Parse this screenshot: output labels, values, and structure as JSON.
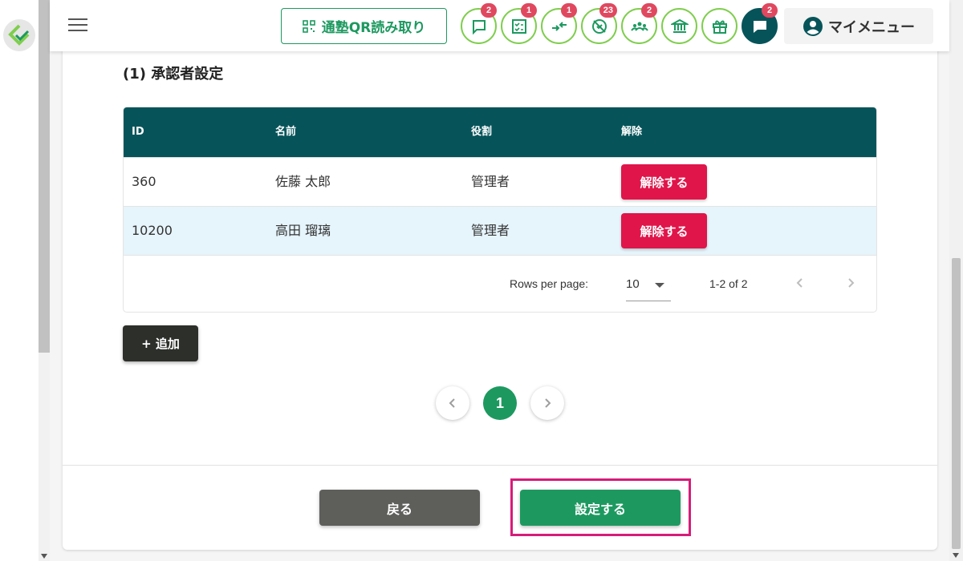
{
  "header": {
    "qr_button_label": "通塾QR読み取り",
    "icons": [
      {
        "name": "chat-bubble-icon",
        "badge": "2"
      },
      {
        "name": "checklist-icon",
        "badge": "1"
      },
      {
        "name": "swap-arrows-icon",
        "badge": "1"
      },
      {
        "name": "no-attendance-icon",
        "badge": "23"
      },
      {
        "name": "group-icon",
        "badge": "2"
      },
      {
        "name": "bank-icon",
        "badge": ""
      },
      {
        "name": "gift-icon",
        "badge": ""
      },
      {
        "name": "message-icon",
        "badge": "2"
      }
    ],
    "my_menu_label": "マイメニュー"
  },
  "section": {
    "title": "(1) 承認者設定"
  },
  "table": {
    "columns": [
      "ID",
      "名前",
      "役割",
      "解除"
    ],
    "rows": [
      {
        "id": "360",
        "name": "佐藤 太郎",
        "role": "管理者",
        "action": "解除する"
      },
      {
        "id": "10200",
        "name": "高田 瑠璃",
        "role": "管理者",
        "action": "解除する"
      }
    ],
    "footer": {
      "rows_per_page_label": "Rows per page:",
      "rows_per_page_value": "10",
      "range_text": "1-2 of 2"
    }
  },
  "add_button_label": "+ 追加",
  "pagination": {
    "current_page": "1"
  },
  "actions": {
    "back_label": "戻る",
    "submit_label": "設定する"
  },
  "colors": {
    "brand_green": "#1d9960",
    "header_teal": "#06545a",
    "danger_red": "#e0154a",
    "badge_pink": "#e0485f",
    "highlight_magenta": "#d81b7a"
  }
}
